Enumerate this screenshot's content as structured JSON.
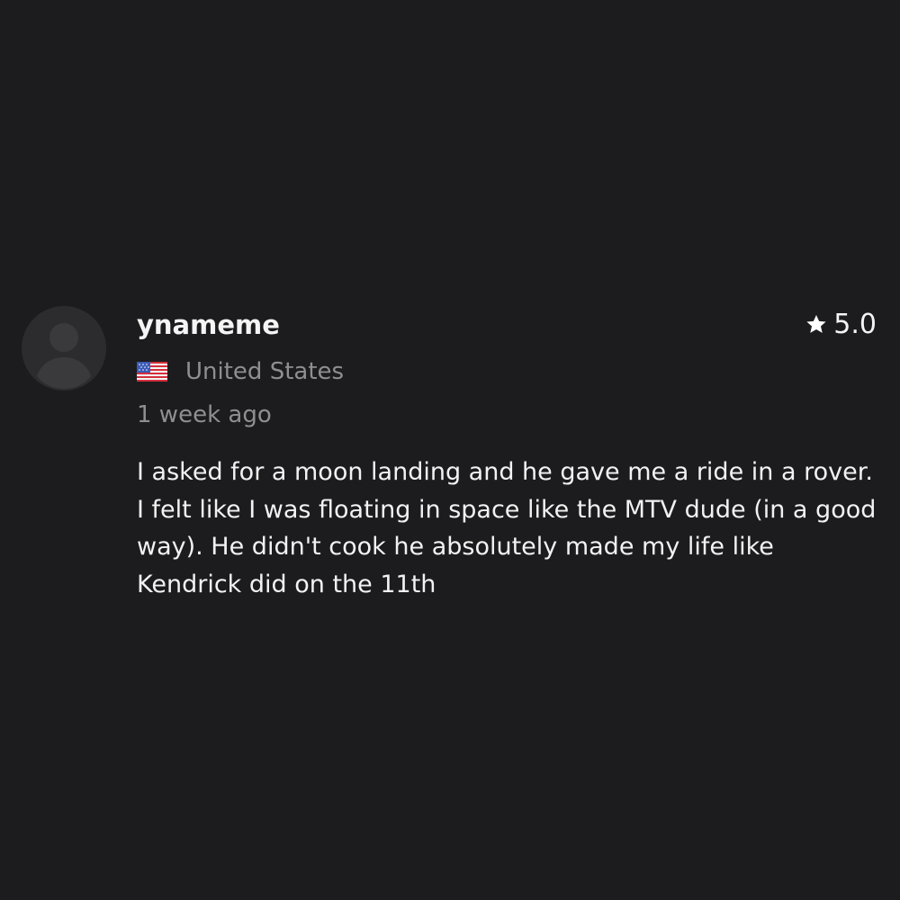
{
  "review": {
    "avatar_icon": "user-silhouette-icon",
    "username": "ynameme",
    "rating": {
      "icon": "star-icon",
      "value": "5.0"
    },
    "location": {
      "flag_icon": "us-flag-icon",
      "country": "United States"
    },
    "timestamp": "1 week ago",
    "text": "I asked for a moon landing and he gave me a ride in a rover. I felt like I was floating in space like the MTV dude (in a good way). He didn't cook he absolutely made my life like Kendrick did on the 11th"
  },
  "colors": {
    "background": "#1c1c1e",
    "avatar_background": "#2c2c2e",
    "avatar_silhouette": "#3a3a3c",
    "primary_text": "#f2f2f2",
    "secondary_text": "#8e8e93"
  }
}
